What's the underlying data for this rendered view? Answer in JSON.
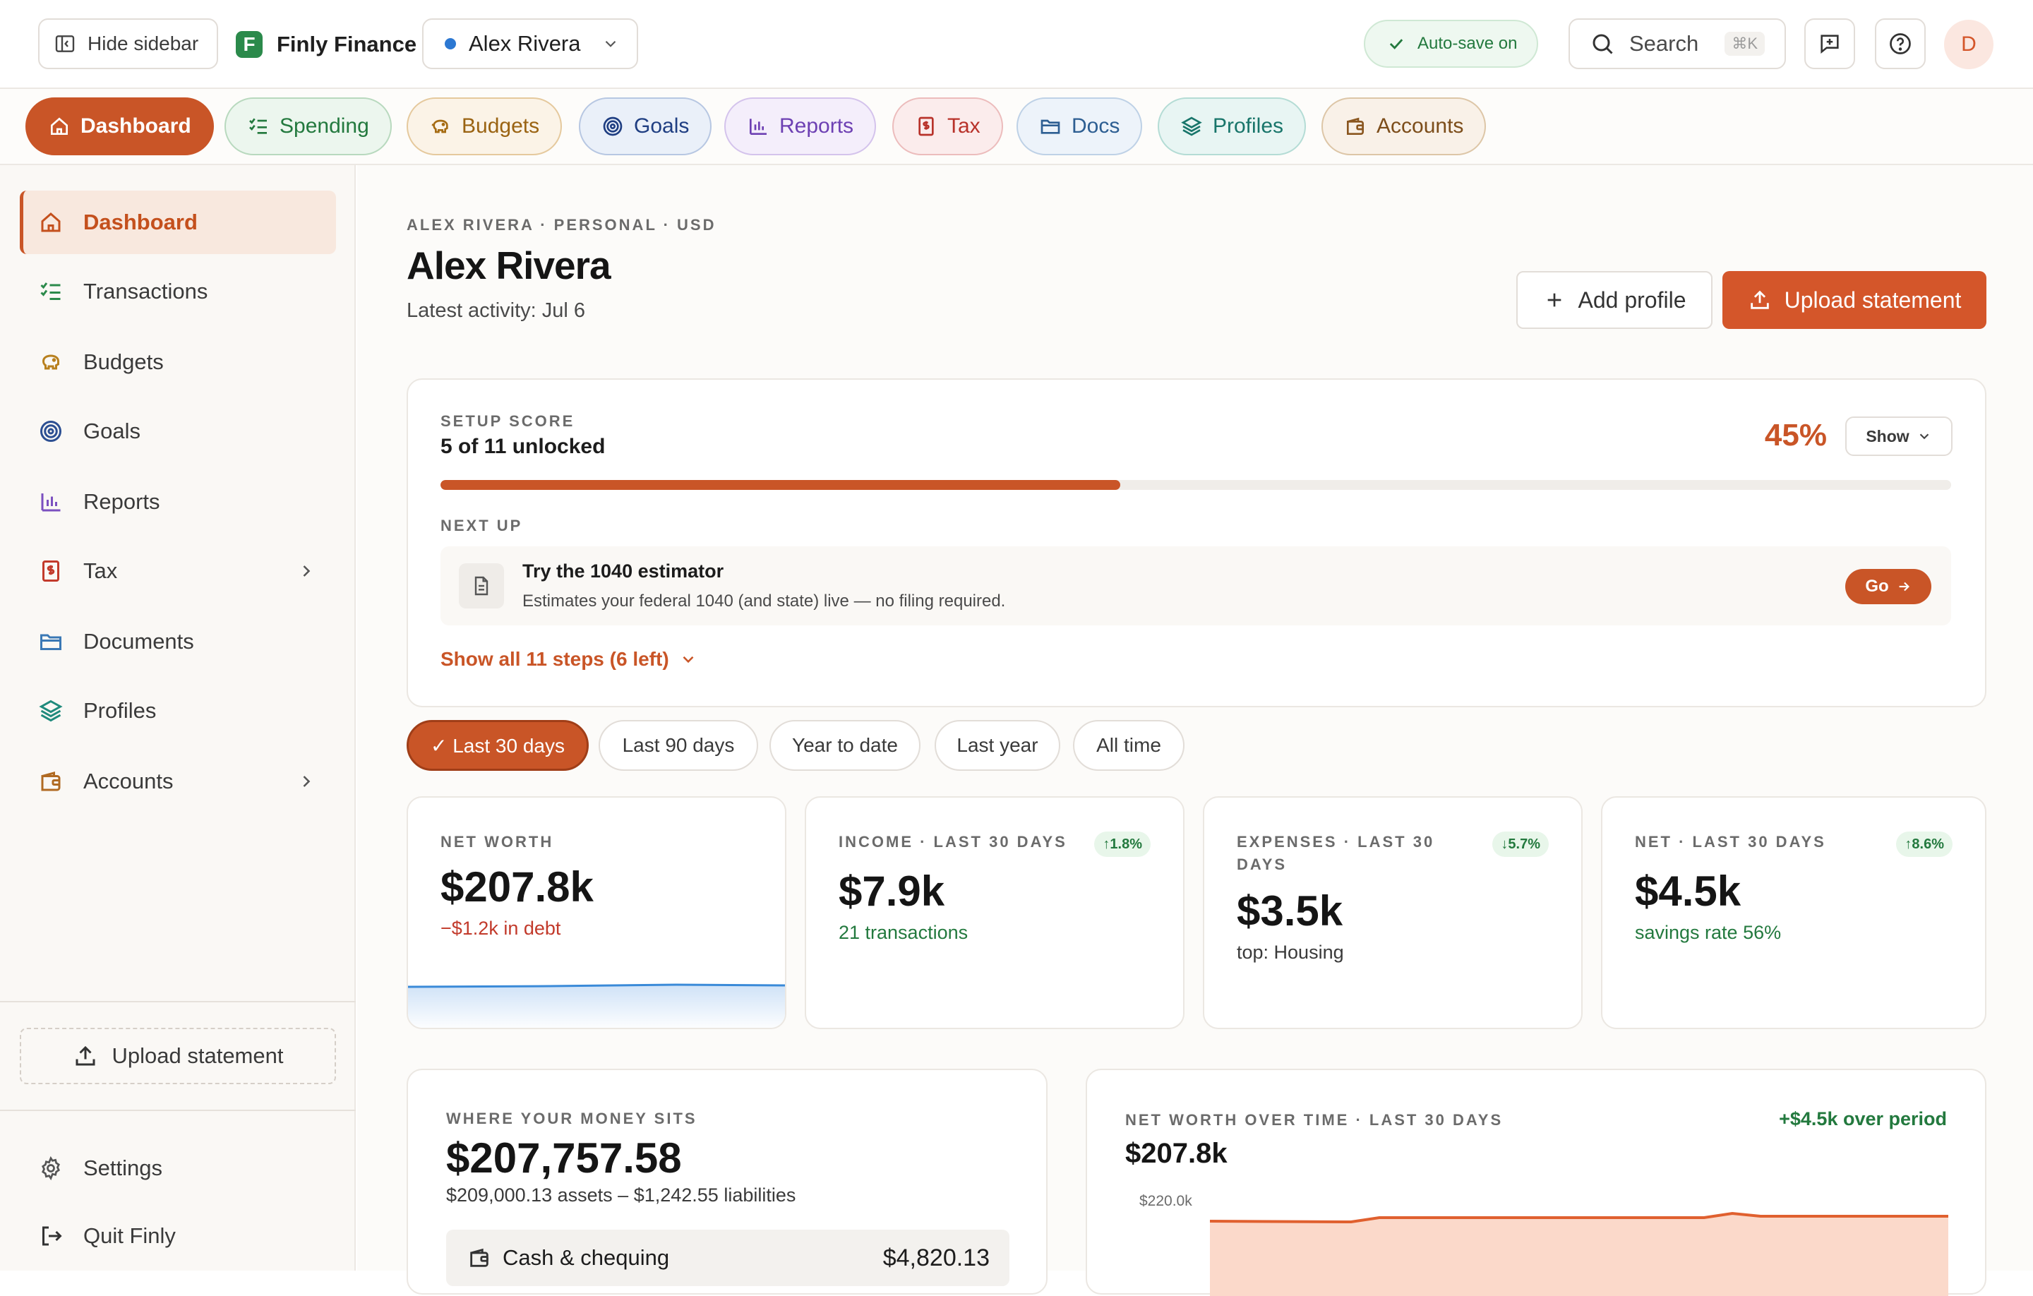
{
  "topbar": {
    "hide_sidebar": "Hide sidebar",
    "brand_letter": "F",
    "brand_name": "Finly Finance",
    "profile_name": "Alex Rivera",
    "autosave": "Auto-save on",
    "search_label": "Search",
    "search_shortcut": "⌘K",
    "avatar_initial": "D"
  },
  "tabs": [
    {
      "label": "Dashboard",
      "icon": "home-icon",
      "active": true
    },
    {
      "label": "Spending",
      "icon": "list-check-icon"
    },
    {
      "label": "Budgets",
      "icon": "piggy-bank-icon"
    },
    {
      "label": "Goals",
      "icon": "target-icon"
    },
    {
      "label": "Reports",
      "icon": "bar-chart-icon"
    },
    {
      "label": "Tax",
      "icon": "tax-document-icon"
    },
    {
      "label": "Docs",
      "icon": "folder-icon"
    },
    {
      "label": "Profiles",
      "icon": "layers-icon"
    },
    {
      "label": "Accounts",
      "icon": "wallet-icon"
    }
  ],
  "sidebar": {
    "items": [
      {
        "label": "Dashboard",
        "icon": "home-icon"
      },
      {
        "label": "Transactions",
        "icon": "list-check-icon"
      },
      {
        "label": "Budgets",
        "icon": "piggy-bank-icon"
      },
      {
        "label": "Goals",
        "icon": "target-icon"
      },
      {
        "label": "Reports",
        "icon": "bar-chart-icon"
      },
      {
        "label": "Tax",
        "icon": "tax-document-icon"
      },
      {
        "label": "Documents",
        "icon": "folder-icon"
      },
      {
        "label": "Profiles",
        "icon": "layers-icon"
      },
      {
        "label": "Accounts",
        "icon": "wallet-icon"
      }
    ],
    "upload": "Upload statement",
    "settings": "Settings",
    "quit": "Quit Finly"
  },
  "header": {
    "eyebrow": "ALEX RIVERA · PERSONAL · USD",
    "title": "Alex Rivera",
    "latest": "Latest activity: Jul 6",
    "add_profile": "Add profile",
    "upload": "Upload statement"
  },
  "setup": {
    "eyebrow": "SETUP SCORE",
    "unlocked": "5 of 11 unlocked",
    "percent_text": "45%",
    "progress": 0.45,
    "show": "Show",
    "next_up": "NEXT UP",
    "task_title": "Try the 1040 estimator",
    "task_desc": "Estimates your federal 1040 (and state) live — no filing required.",
    "go": "Go",
    "show_all": "Show all 11 steps (6 left)"
  },
  "periods": [
    "✓ Last 30 days",
    "Last 90 days",
    "Year to date",
    "Last year",
    "All time"
  ],
  "stats": {
    "net_worth": {
      "label": "NET WORTH",
      "value": "$207.8k",
      "sub": "−$1.2k in debt"
    },
    "income": {
      "label": "INCOME · LAST 30 DAYS",
      "badge": "↑1.8%",
      "value": "$7.9k",
      "sub": "21 transactions"
    },
    "expenses": {
      "label_1": "EXPENSES · LAST 30",
      "label_2": "DAYS",
      "badge": "↓5.7%",
      "value": "$3.5k",
      "sub": "top: Housing"
    },
    "net": {
      "label": "NET · LAST 30 DAYS",
      "badge": "↑8.6%",
      "value": "$4.5k",
      "sub": "savings rate 56%"
    }
  },
  "money": {
    "eyebrow": "WHERE YOUR MONEY SITS",
    "total": "$207,757.58",
    "breakdown": "$209,000.13 assets – $1,242.55 liabilities",
    "row_label": "Cash & chequing",
    "row_value": "$4,820.13"
  },
  "networth_chart": {
    "eyebrow": "NET WORTH OVER TIME · LAST 30 DAYS",
    "value": "$207.8k",
    "delta": "+$4.5k over period",
    "y_tick": "$220.0k"
  },
  "colors": {
    "accent": "#c95527",
    "accent_bright": "#d4562a",
    "positive": "#23793e",
    "negative": "#c23a2b",
    "sidebar_bg": "#faf8f5"
  }
}
